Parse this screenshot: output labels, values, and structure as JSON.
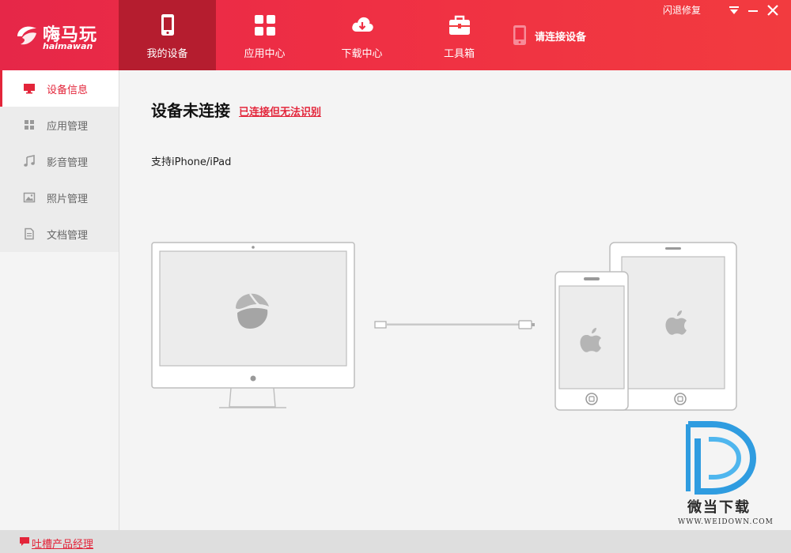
{
  "app": {
    "logo_text": "嗨马玩",
    "logo_sub": "haimawan"
  },
  "nav": {
    "tabs": [
      {
        "label": "我的设备",
        "icon": "phone-icon",
        "active": true
      },
      {
        "label": "应用中心",
        "icon": "apps-grid-icon",
        "active": false
      },
      {
        "label": "下载中心",
        "icon": "cloud-download-icon",
        "active": false
      },
      {
        "label": "工具箱",
        "icon": "toolbox-icon",
        "active": false
      }
    ],
    "device_status": "请连接设备",
    "crash_fix": "闪退修复"
  },
  "window_controls": {
    "menu": "▼",
    "minimize": "—",
    "close": "✕"
  },
  "sidebar": {
    "items": [
      {
        "label": "设备信息",
        "icon": "monitor-icon",
        "active": true
      },
      {
        "label": "应用管理",
        "icon": "grid-icon",
        "active": false
      },
      {
        "label": "影音管理",
        "icon": "music-note-icon",
        "active": false
      },
      {
        "label": "照片管理",
        "icon": "photo-icon",
        "active": false
      },
      {
        "label": "文档管理",
        "icon": "document-icon",
        "active": false
      }
    ]
  },
  "main": {
    "status_title": "设备未连接",
    "status_link": "已连接但无法识别",
    "support_text": "支持iPhone/iPad"
  },
  "watermark": {
    "text": "微当下载",
    "url": "WWW.WEIDOWN.COM"
  },
  "footer": {
    "feedback_label": "吐槽产品经理"
  },
  "colors": {
    "brand_red": "#ef2f44",
    "active_tab": "#b51d2f",
    "accent": "#e3253a",
    "watermark_blue": "#2f9ce0"
  }
}
